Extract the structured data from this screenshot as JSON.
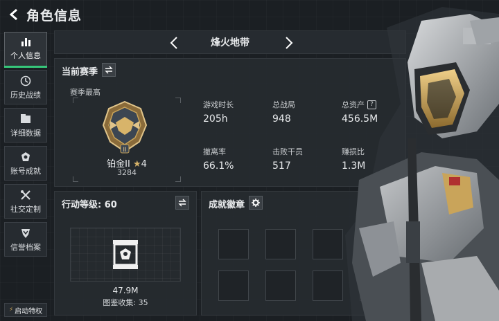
{
  "header": {
    "title": "角色信息"
  },
  "sidebar": {
    "items": [
      {
        "label": "个人信息",
        "icon": "bar-chart-icon"
      },
      {
        "label": "历史战绩",
        "icon": "history-icon"
      },
      {
        "label": "详细数据",
        "icon": "data-folder-icon"
      },
      {
        "label": "账号成就",
        "icon": "achievement-icon"
      },
      {
        "label": "社交定制",
        "icon": "tools-icon"
      },
      {
        "label": "信誉档案",
        "icon": "shield-icon"
      }
    ],
    "start_privilege": "启动特权"
  },
  "map_selector": {
    "name": "烽火地带"
  },
  "season": {
    "title": "当前赛季",
    "best_label": "赛季最高",
    "rank_name": "铂金II",
    "rank_stars": "4",
    "rank_score": "3284",
    "stats": [
      {
        "label": "游戏时长",
        "value": "205h"
      },
      {
        "label": "总战局",
        "value": "948"
      },
      {
        "label": "总资产",
        "value": "456.5M"
      },
      {
        "label": "撤离率",
        "value": "66.1%"
      },
      {
        "label": "击败干员",
        "value": "517"
      },
      {
        "label": "赚损比",
        "value": "1.3M"
      }
    ]
  },
  "action_level": {
    "title": "行动等级: 60",
    "collection_value": "47.9M",
    "collection_count": "图鉴收集: 35"
  },
  "achievements": {
    "title": "成就徽章"
  },
  "colors": {
    "accent_green": "#36c77a",
    "panel": "#262b30",
    "gold": "#c9a45a"
  }
}
